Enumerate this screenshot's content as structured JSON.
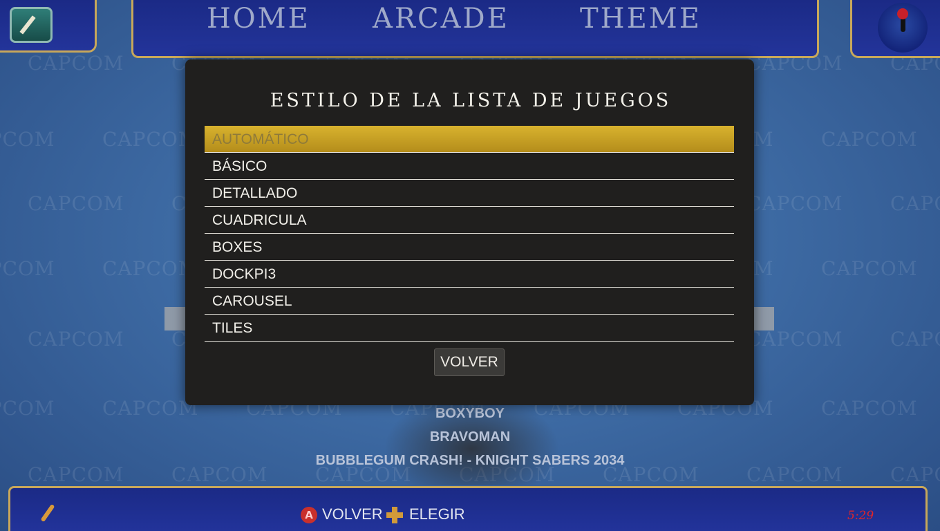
{
  "nav": {
    "items": [
      "HOME",
      "ARCADE",
      "THEME"
    ]
  },
  "background": {
    "watermark": "CAPCOM",
    "games": [
      "BOXYBOY",
      "BRAVOMAN",
      "BUBBLEGUM CRASH! - KNIGHT SABERS 2034"
    ]
  },
  "dialog": {
    "title": "ESTILO DE LA LISTA DE JUEGOS",
    "options": [
      "AUTOMÁTICO",
      "BÁSICO",
      "DETALLADO",
      "CUADRICULA",
      "BOXES",
      "DOCKPI3",
      "CAROUSEL",
      "TILES"
    ],
    "selected_index": 0,
    "back_label": "VOLVER"
  },
  "bottom": {
    "hint_back": "VOLVER",
    "hint_select": "ELEGIR",
    "clock": "5:29"
  },
  "colors": {
    "selected": "#c9a226",
    "dialog_bg": "#201f1e",
    "bar_blue": "#1b2a86",
    "gold_border": "#c8a85a",
    "clock_red": "#e0252a"
  },
  "icons": [
    "app-icon",
    "joystick-icon",
    "feather-icon",
    "button-a-icon",
    "dpad-icon"
  ]
}
